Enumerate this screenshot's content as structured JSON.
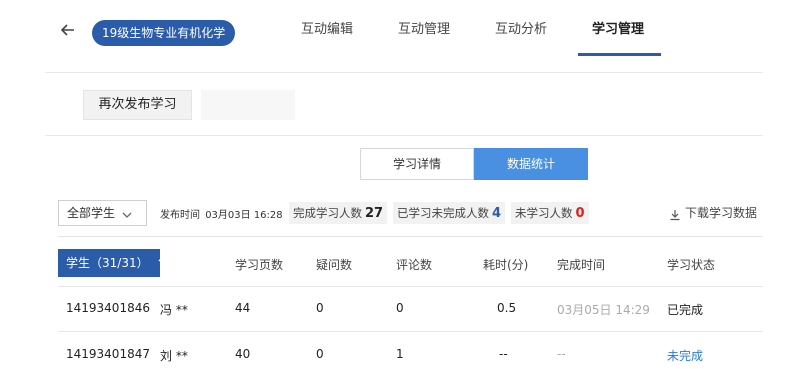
{
  "header": {
    "course_name": "19级生物专业有机化学",
    "tabs": [
      {
        "label": "互动编辑"
      },
      {
        "label": "互动管理"
      },
      {
        "label": "互动分析"
      },
      {
        "label": "学习管理"
      }
    ],
    "active_tab": "学习管理"
  },
  "actions": {
    "republish_label": "再次发布学习"
  },
  "view_toggle": {
    "detail_label": "学习详情",
    "stats_label": "数据统计",
    "active": "数据统计"
  },
  "filters": {
    "student_filter": "全部学生",
    "publish_time_label": "发布时间",
    "publish_time_value": "03月03日 16:28",
    "completed_label": "完成学习人数",
    "completed_count": "27",
    "incomplete_label": "已学习未完成人数",
    "incomplete_count": "4",
    "not_started_label": "未学习人数",
    "not_started_count": "0",
    "download_label": "下载学习数据"
  },
  "table": {
    "sort_header": "学生（31/31）",
    "headers": {
      "pages": "学习页数",
      "questions": "疑问数",
      "comments": "评论数",
      "time": "耗时(分)",
      "finish_time": "完成时间",
      "status": "学习状态"
    },
    "rows": [
      {
        "id": "14193401846",
        "name": "冯 **",
        "pages": "44",
        "questions": "0",
        "comments": "0",
        "time": "0.5",
        "finish_time": "03月05日 14:29",
        "status": "已完成"
      },
      {
        "id": "14193401847",
        "name": "刘 **",
        "pages": "40",
        "questions": "0",
        "comments": "1",
        "time": "--",
        "finish_time": "--",
        "status": "未完成"
      }
    ]
  },
  "colors": {
    "primary": "#2a5caa",
    "toggle_active": "#4a90e2",
    "status_incomplete": "#2a7bd3",
    "count_incomplete": "#2a5caa",
    "count_not_started": "#e02020"
  }
}
